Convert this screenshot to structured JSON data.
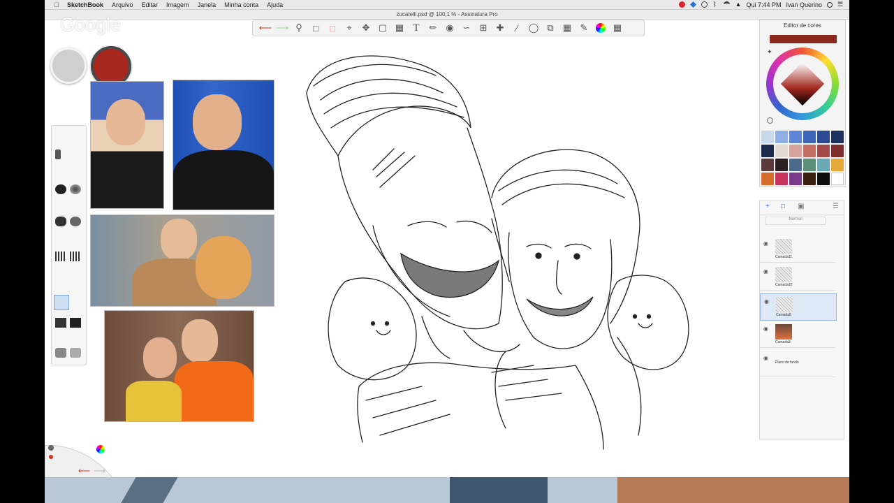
{
  "menubar": {
    "app_name": "SketchBook",
    "items": [
      "Arquivo",
      "Editar",
      "Imagem",
      "Janela",
      "Minha conta",
      "Ajuda"
    ],
    "clock": "Qui 7:44 PM",
    "user": "Ivan Querino"
  },
  "window": {
    "title": "zucatelli.psd @ 100,1 % - Assinatura Pro"
  },
  "overlay": {
    "watermark": "Google"
  },
  "toolbar": {
    "tools": [
      "undo-icon",
      "redo-icon",
      "zoom-icon",
      "select-icon",
      "lasso-icon",
      "crop-icon",
      "move-icon",
      "transform-icon",
      "distort-icon",
      "text-icon",
      "ruler-icon",
      "ellipse-guide-icon",
      "french-curve-icon",
      "perspective-icon",
      "symmetry-icon",
      "stroke-icon",
      "shape-icon",
      "copy-icon",
      "fill-icon",
      "brush-library-icon",
      "color-wheel-icon",
      "layers-icon"
    ]
  },
  "color_editor": {
    "title": "Editor de cores",
    "current_color": "#8b2a1f",
    "swatches": [
      "#c9d9ec",
      "#8fb0e3",
      "#5d86d4",
      "#3c64b7",
      "#2b4a92",
      "#1f325f",
      "#1c2b4c",
      "#e5dbd5",
      "#d7a29b",
      "#c46d62",
      "#a34b4b",
      "#7e2d2d",
      "#5a3a3a",
      "#2b1f1f",
      "#4d6a8b",
      "#5b8f78",
      "#6aa9b4",
      "#e5a93a",
      "#d46c2c",
      "#c7335b",
      "#7a3b8a",
      "#3b2010",
      "#0d0d0d",
      "#ffffff"
    ]
  },
  "layers_panel": {
    "blend_mode": "Normal",
    "layers": [
      {
        "name": "Camada11",
        "selected": false
      },
      {
        "name": "Camada12",
        "selected": false
      },
      {
        "name": "Camada8",
        "selected": true
      },
      {
        "name": "Camada3",
        "selected": false
      },
      {
        "name": "Plano de fundo",
        "selected": false
      }
    ]
  },
  "colors": {
    "puck_primary": "#a8281f",
    "puck_secondary": "#cfcfcf"
  }
}
